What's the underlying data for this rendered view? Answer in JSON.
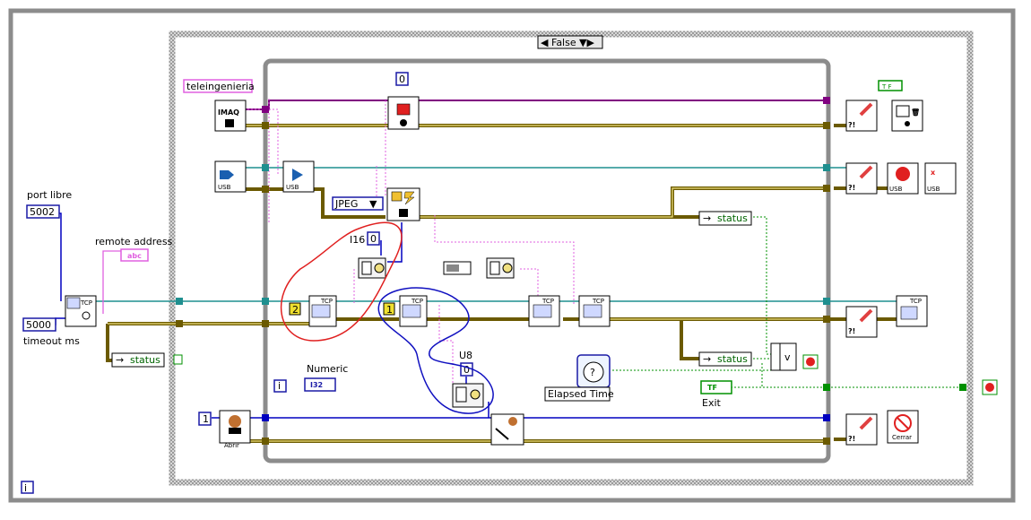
{
  "case_selector": {
    "value": "False",
    "left_arrow": "◀",
    "right_arrow": "▼▶"
  },
  "loop_index_label": "i",
  "controls": {
    "port_label": "port libre",
    "port_value": "5002",
    "timeout_value": "5000",
    "timeout_label": "timeout ms",
    "remote_address_label": "remote address",
    "remote_address_type": "abc",
    "status_label": "status",
    "camera_name": "teleingenieria",
    "image_format": "JPEG",
    "constant_zero": "0",
    "constant_zero_u8": "0",
    "constant_zero_i16": "0",
    "i16_label": "I16",
    "u8_label": "U8",
    "const_two": "2",
    "const_one": "1",
    "const_one_blue": "1",
    "numeric_label": "Numeric",
    "numeric_type": "I32",
    "inner_index": "i",
    "elapsed_time_label": "Elapsed Time",
    "exit_label": "Exit",
    "exit_type": "TF",
    "status_label_2": "status",
    "status_label_3": "status",
    "abrir_label": "Abrir",
    "cerrar_label": "Cerrar",
    "tf_const": "T F"
  },
  "icons": {
    "imaq": "IMAQ",
    "tcp": "TCP",
    "usb": "USB"
  },
  "colors": {
    "error_wire": "#6b5a00",
    "refnum_wire": "#1f8f8f",
    "string_wire": "#e060e0",
    "numeric_blue": "#0000c0",
    "bool_green": "#009000",
    "annotation_red": "#e02020",
    "annotation_blue": "#1010c0"
  }
}
